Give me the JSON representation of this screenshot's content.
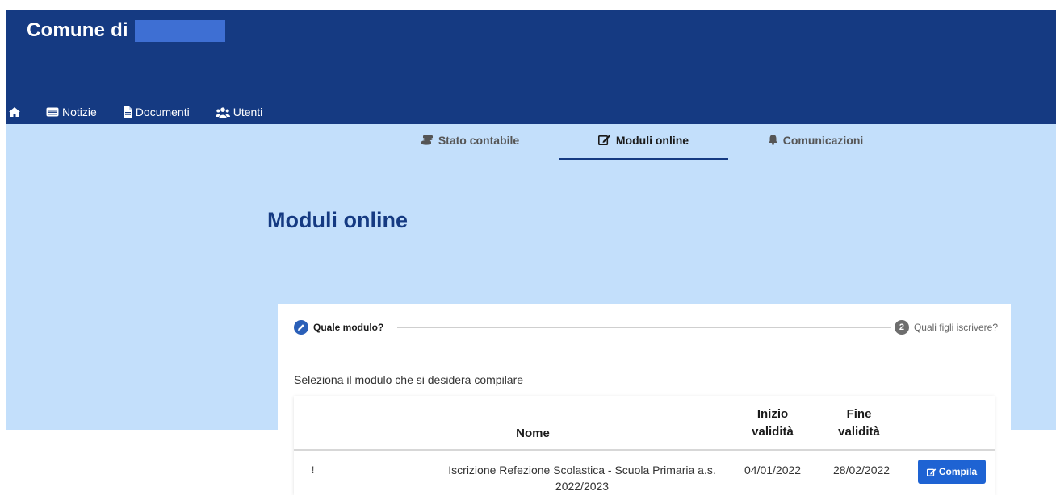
{
  "header": {
    "brand": "Comune di"
  },
  "nav": {
    "home_icon": "home-icon",
    "items": [
      {
        "label": "Notizie",
        "icon": "newspaper-icon"
      },
      {
        "label": "Documenti",
        "icon": "document-icon"
      },
      {
        "label": "Utenti",
        "icon": "users-icon"
      }
    ]
  },
  "tabs": [
    {
      "label": "Stato contabile",
      "icon": "coins-icon",
      "active": false
    },
    {
      "label": "Moduli online",
      "icon": "edit-icon",
      "active": true
    },
    {
      "label": "Comunicazioni",
      "icon": "bell-icon",
      "active": false
    }
  ],
  "page": {
    "title": "Moduli online"
  },
  "stepper": {
    "step1": {
      "label": "Quale modulo?",
      "icon": "pencil-icon"
    },
    "step2": {
      "label": "Quali figli iscrivere?",
      "number": "2"
    }
  },
  "instruction": "Seleziona il modulo che si desidera compilare",
  "table": {
    "headers": {
      "nome": "Nome",
      "inizio_line1": "Inizio",
      "inizio_line2": "validità",
      "fine_line1": "Fine",
      "fine_line2": "validità"
    },
    "rows": [
      {
        "id": "!",
        "nome": "Iscrizione Refezione Scolastica - Scuola Primaria a.s. 2022/2023",
        "inizio": "04/01/2022",
        "fine": "28/02/2022",
        "action": "Compila"
      }
    ]
  },
  "colors": {
    "header_bg": "#153a82",
    "hero_bg": "#c3dffb",
    "accent": "#1e63d3",
    "title": "#153a82"
  }
}
